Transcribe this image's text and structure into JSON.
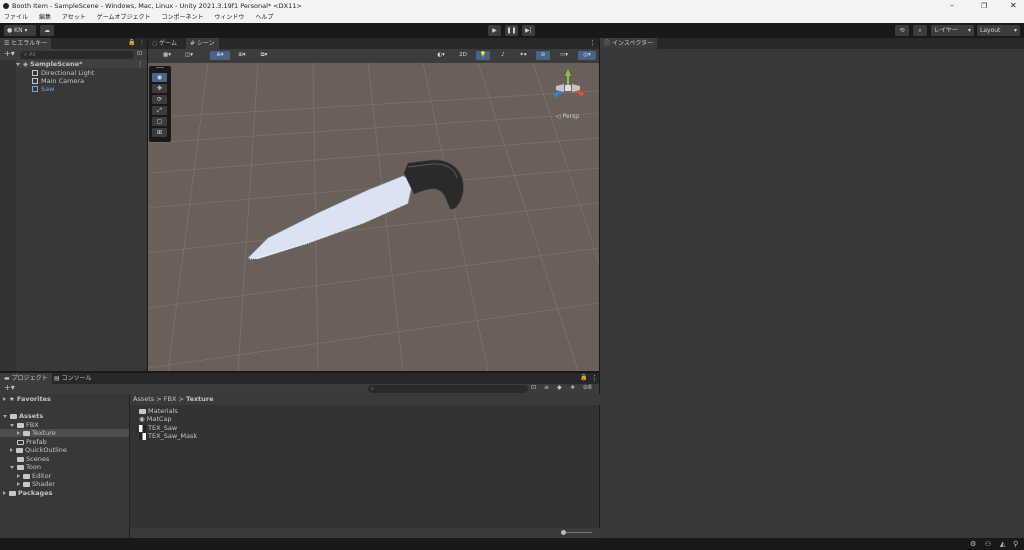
{
  "window": {
    "title": "Booth Item - SampleScene - Windows, Mac, Linux - Unity 2021.3.19f1 Personal* <DX11>"
  },
  "menu": [
    "ファイル",
    "編集",
    "アセット",
    "ゲームオブジェクト",
    "コンポーネント",
    "ウィンドウ",
    "ヘルプ"
  ],
  "toolbar": {
    "account": "KN",
    "layers": "レイヤー",
    "layout": "Layout"
  },
  "hierarchy": {
    "tab": "ヒエラルキー",
    "search_placeholder": "All",
    "scene": "SampleScene*",
    "items": [
      "Directional Light",
      "Main Camera",
      "Saw"
    ]
  },
  "scene_view": {
    "tabs": [
      "ゲーム",
      "シーン"
    ],
    "tools": [
      "◉",
      "✥",
      "⟳",
      "⤢",
      "▢",
      "⊞"
    ],
    "mode_2d": "2D",
    "persp": "Persp"
  },
  "inspector": {
    "tab": "インスペクター"
  },
  "project": {
    "tabs": [
      "プロジェクト",
      "コンソール"
    ],
    "favorites": "Favorites",
    "assets": "Assets",
    "tree": [
      {
        "label": "FBX",
        "depth": 1,
        "expanded": true
      },
      {
        "label": "Texture",
        "depth": 2,
        "expanded": false,
        "selected": true
      },
      {
        "label": "Prefab",
        "depth": 1,
        "expanded": null
      },
      {
        "label": "QuickOutline",
        "depth": 1,
        "expanded": false
      },
      {
        "label": "Scenes",
        "depth": 1,
        "expanded": null
      },
      {
        "label": "Toon",
        "depth": 1,
        "expanded": true
      },
      {
        "label": "Editor",
        "depth": 2,
        "expanded": false
      },
      {
        "label": "Shader",
        "depth": 2,
        "expanded": false
      }
    ],
    "packages": "Packages",
    "breadcrumb": [
      "Assets",
      "FBX",
      "Texture"
    ],
    "files": [
      "Materials",
      "MatCap",
      "TEX_Saw",
      "TEX_Saw_Mask"
    ]
  },
  "colors": {
    "accent": "#4a6488",
    "selected": "#2c5d87",
    "scene_bg": "#6b6059"
  }
}
